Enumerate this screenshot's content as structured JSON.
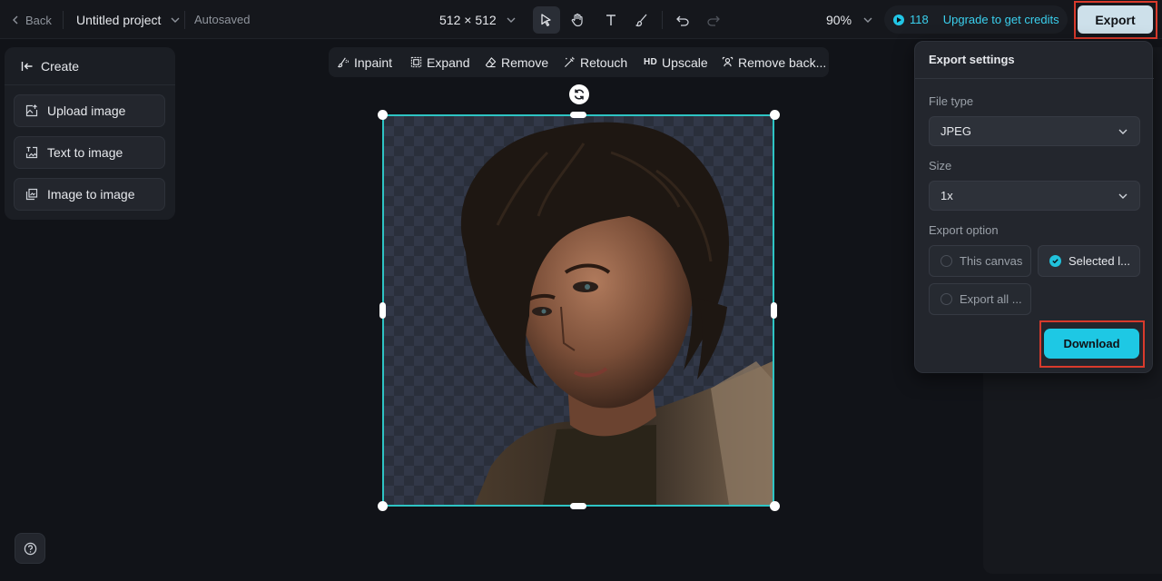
{
  "topbar": {
    "back_label": "Back",
    "project_name": "Untitled project",
    "save_status": "Autosaved",
    "canvas_size": "512 × 512",
    "zoom": "90%",
    "credits": "118",
    "upgrade_label": "Upgrade to get credits",
    "export_label": "Export",
    "tools": [
      "select-pointer-icon",
      "hand-pan-icon",
      "text-icon",
      "brush-icon",
      "undo-icon",
      "redo-icon"
    ]
  },
  "left_panel": {
    "header": "Create",
    "items": [
      {
        "label": "Upload image",
        "icon": "upload-image-icon"
      },
      {
        "label": "Text to image",
        "icon": "text-to-image-icon"
      },
      {
        "label": "Image to image",
        "icon": "image-to-image-icon"
      }
    ]
  },
  "edit_toolbar": {
    "items": [
      {
        "label": "Inpaint",
        "icon": "inpaint-icon"
      },
      {
        "label": "Expand",
        "icon": "expand-icon"
      },
      {
        "label": "Remove",
        "icon": "eraser-icon"
      },
      {
        "label": "Retouch",
        "icon": "retouch-wand-icon"
      },
      {
        "label": "Upscale",
        "icon": "hd-icon",
        "icon_text": "HD"
      },
      {
        "label": "Remove back...",
        "icon": "remove-background-icon"
      }
    ]
  },
  "export_settings": {
    "title": "Export settings",
    "file_type_label": "File type",
    "file_type_value": "JPEG",
    "size_label": "Size",
    "size_value": "1x",
    "export_option_label": "Export option",
    "options": [
      {
        "label": "This canvas",
        "selected": false
      },
      {
        "label": "Selected l...",
        "selected": true
      },
      {
        "label": "Export all ...",
        "selected": false
      }
    ],
    "download_label": "Download"
  },
  "colors": {
    "accent": "#1ec8e4",
    "selection": "#2ec4c4",
    "highlight": "#d83a2c",
    "background": "#111318"
  }
}
